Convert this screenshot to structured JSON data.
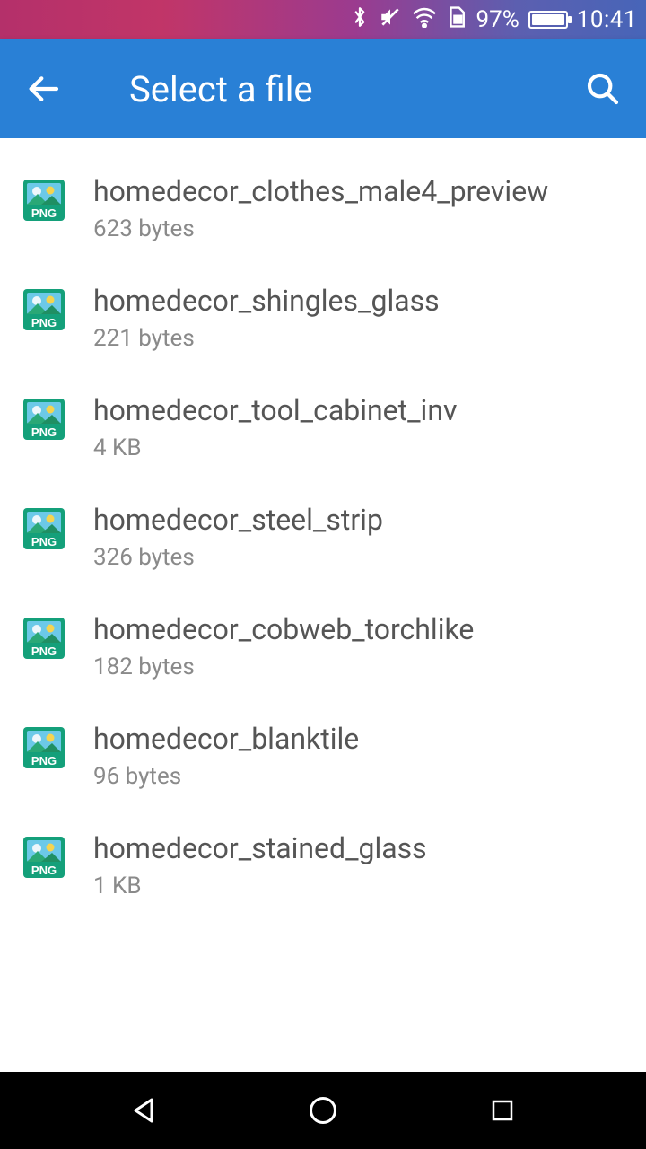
{
  "status": {
    "battery_pct": "97%",
    "time": "10:41"
  },
  "appbar": {
    "title": "Select a file"
  },
  "files": [
    {
      "name": "homedecor_clothes_male4_preview",
      "size": "623 bytes"
    },
    {
      "name": "homedecor_shingles_glass",
      "size": "221 bytes"
    },
    {
      "name": "homedecor_tool_cabinet_inv",
      "size": "4 KB"
    },
    {
      "name": "homedecor_steel_strip",
      "size": "326 bytes"
    },
    {
      "name": "homedecor_cobweb_torchlike",
      "size": "182 bytes"
    },
    {
      "name": "homedecor_blanktile",
      "size": "96 bytes"
    },
    {
      "name": "homedecor_stained_glass",
      "size": "1 KB"
    }
  ]
}
